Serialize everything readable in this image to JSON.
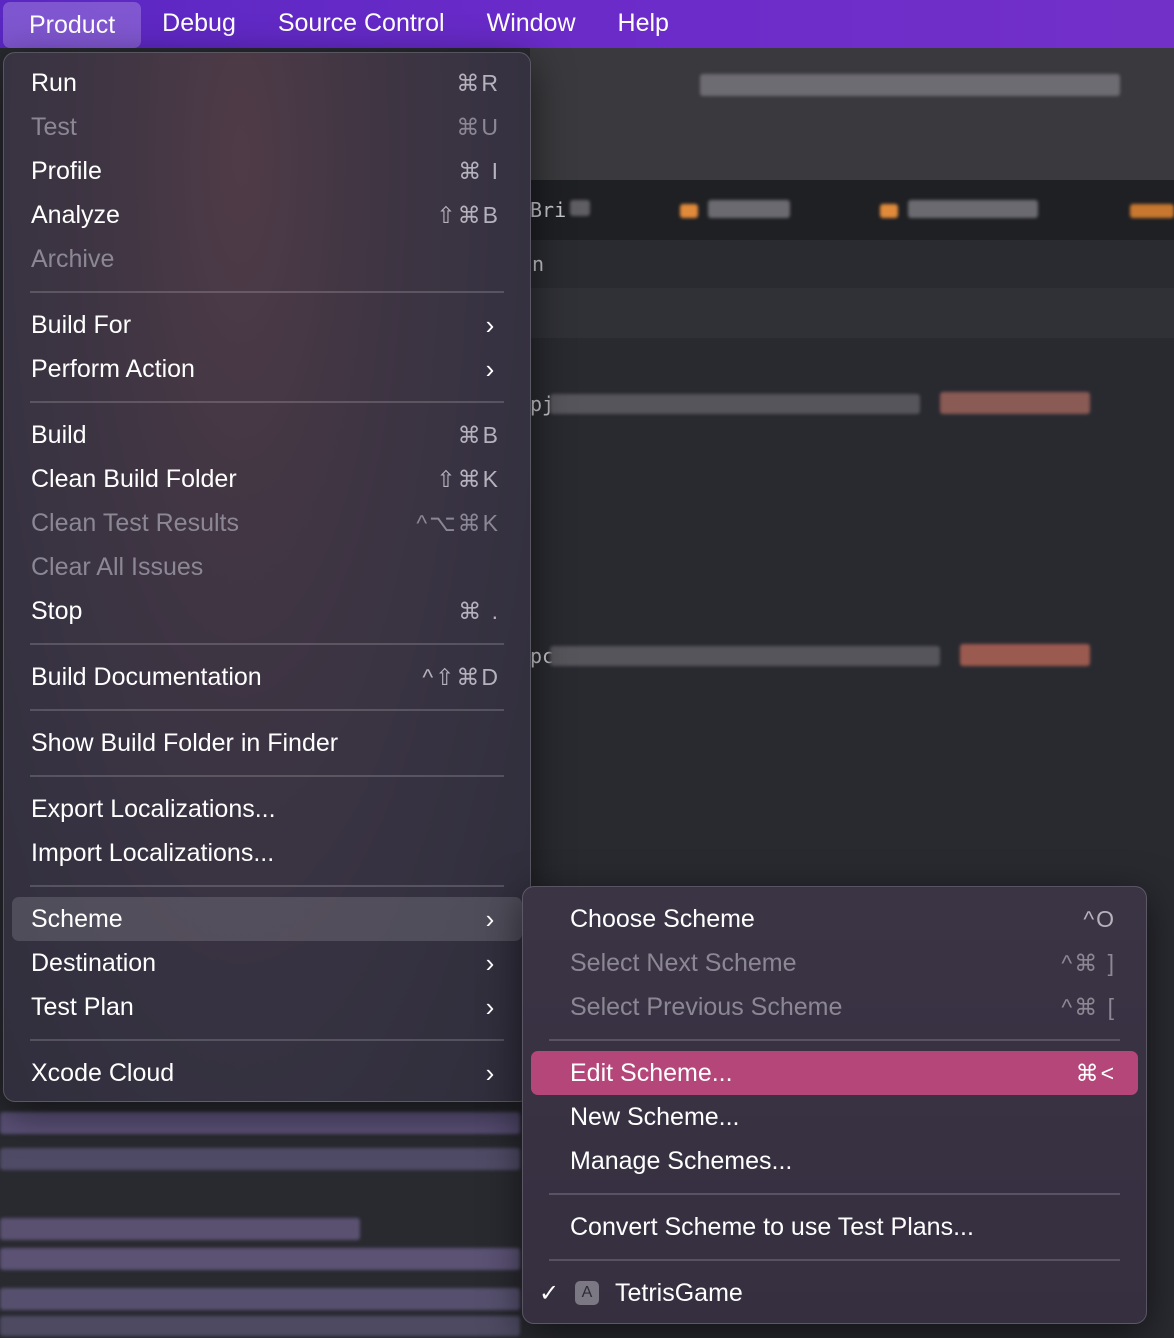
{
  "menubar": {
    "items": [
      "Product",
      "Debug",
      "Source Control",
      "Window",
      "Help"
    ]
  },
  "background": {
    "fragments": [
      "Bri",
      "n",
      "pj",
      "pc"
    ]
  },
  "product_menu": {
    "items": [
      {
        "label": "Run",
        "shortcut": "⌘R",
        "disabled": false
      },
      {
        "label": "Test",
        "shortcut": "⌘U",
        "disabled": true
      },
      {
        "label": "Profile",
        "shortcut": "⌘ I",
        "disabled": false
      },
      {
        "label": "Analyze",
        "shortcut": "⇧⌘B",
        "disabled": false
      },
      {
        "label": "Archive",
        "shortcut": "",
        "disabled": true
      },
      {
        "label": "Build For",
        "submenu": true
      },
      {
        "label": "Perform Action",
        "submenu": true
      },
      {
        "label": "Build",
        "shortcut": "⌘B",
        "disabled": false
      },
      {
        "label": "Clean Build Folder",
        "shortcut": "⇧⌘K",
        "disabled": false
      },
      {
        "label": "Clean Test Results",
        "shortcut": "^⌥⌘K",
        "disabled": true
      },
      {
        "label": "Clear All Issues",
        "shortcut": "",
        "disabled": true
      },
      {
        "label": "Stop",
        "shortcut": "⌘ .",
        "disabled": false
      },
      {
        "label": "Build Documentation",
        "shortcut": "^⇧⌘D",
        "disabled": false
      },
      {
        "label": "Show Build Folder in Finder",
        "shortcut": "",
        "disabled": false
      },
      {
        "label": "Export Localizations...",
        "shortcut": "",
        "disabled": false
      },
      {
        "label": "Import Localizations...",
        "shortcut": "",
        "disabled": false
      },
      {
        "label": "Scheme",
        "submenu": true,
        "highlighted": true
      },
      {
        "label": "Destination",
        "submenu": true
      },
      {
        "label": "Test Plan",
        "submenu": true
      },
      {
        "label": "Xcode Cloud",
        "submenu": true
      }
    ]
  },
  "scheme_menu": {
    "items": [
      {
        "label": "Choose Scheme",
        "shortcut": "^O",
        "disabled": false
      },
      {
        "label": "Select Next Scheme",
        "shortcut": "^⌘ ]",
        "disabled": true
      },
      {
        "label": "Select Previous Scheme",
        "shortcut": "^⌘ [",
        "disabled": true
      },
      {
        "label": "Edit Scheme...",
        "shortcut": "⌘<",
        "disabled": false,
        "highlighted": true
      },
      {
        "label": "New Scheme...",
        "shortcut": "",
        "disabled": false
      },
      {
        "label": "Manage Schemes...",
        "shortcut": "",
        "disabled": false
      },
      {
        "label": "Convert Scheme to use Test Plans...",
        "shortcut": "",
        "disabled": false
      },
      {
        "label": "TetrisGame",
        "checked": true,
        "icon": "app-icon"
      }
    ]
  },
  "icons": {
    "chevron": "chevron-right-icon",
    "check": "checkmark-icon"
  },
  "colors": {
    "menubar": "#6a2bc8",
    "highlight": "#b5467a"
  }
}
